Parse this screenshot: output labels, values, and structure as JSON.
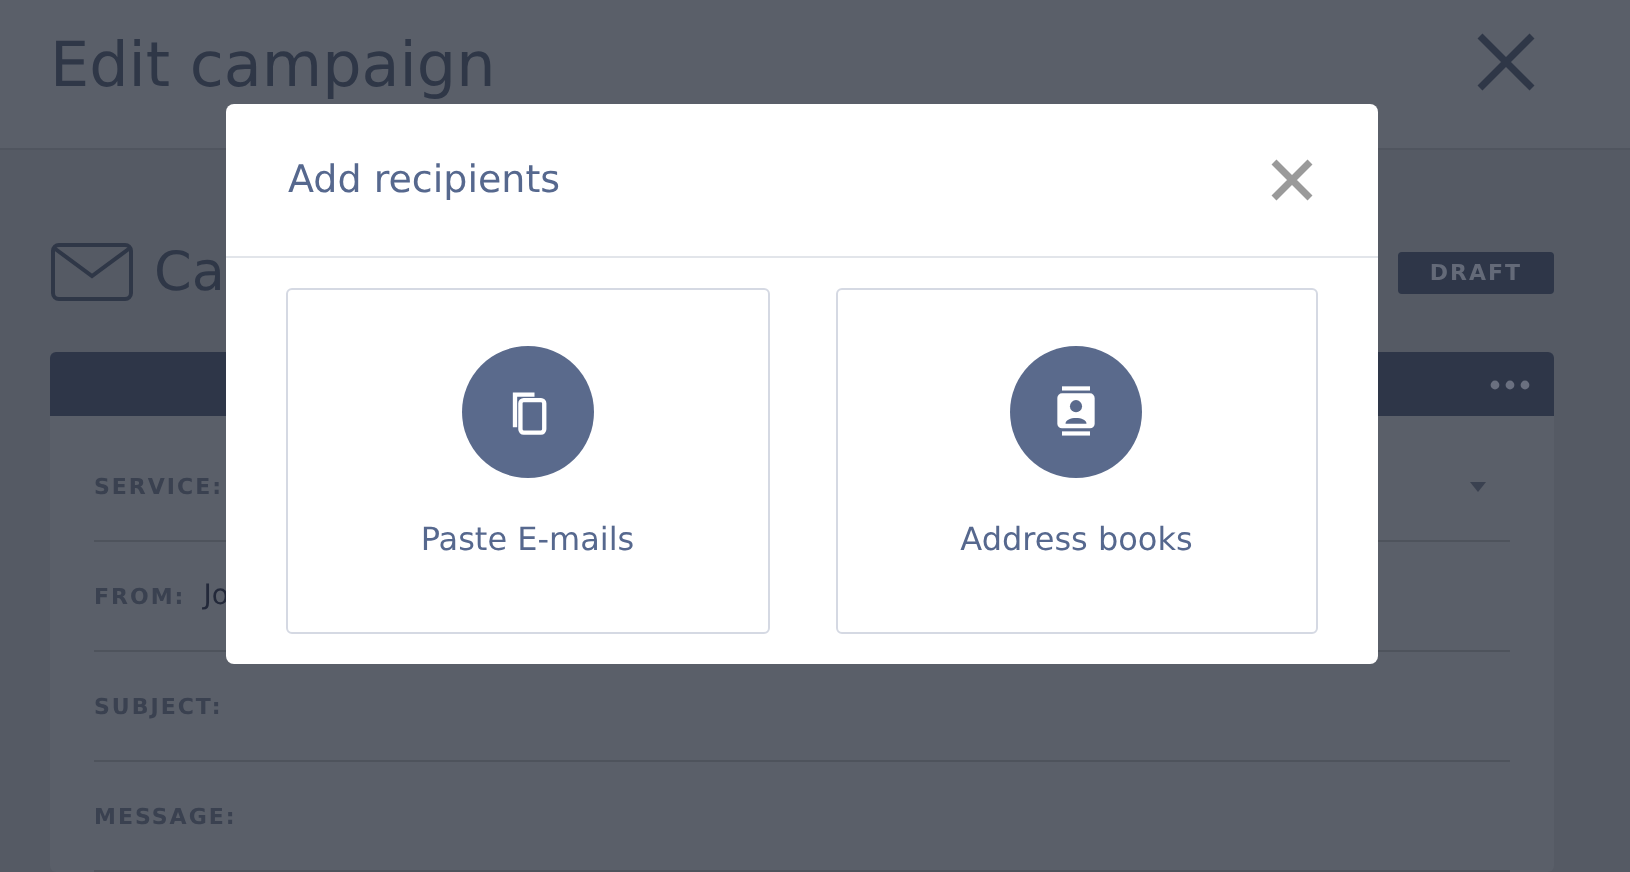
{
  "page": {
    "title": "Edit campaign",
    "campaign_title": "Ca",
    "status_badge": "DRAFT",
    "fields": [
      {
        "label": "SERVICE:",
        "kind": "select"
      },
      {
        "label": "FROM:",
        "kind": "text",
        "value": "Jo"
      },
      {
        "label": "SUBJECT:",
        "kind": "text"
      },
      {
        "label": "MESSAGE:",
        "kind": "text"
      }
    ]
  },
  "dialog": {
    "title": "Add recipients",
    "options": [
      {
        "label": "Paste E-mails",
        "kind": "paste"
      },
      {
        "label": "Address books",
        "kind": "addressbook"
      }
    ]
  }
}
